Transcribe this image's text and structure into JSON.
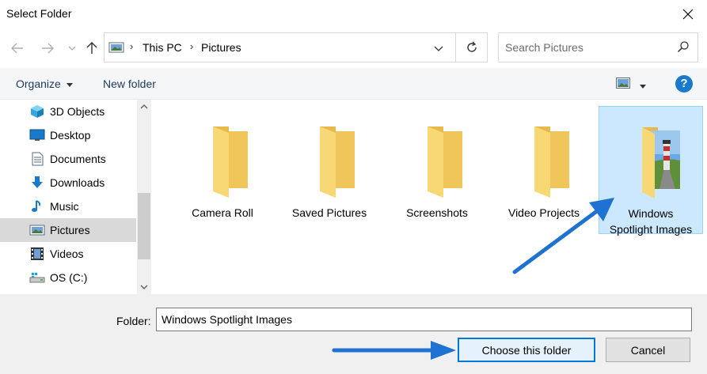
{
  "window": {
    "title": "Select Folder"
  },
  "nav": {
    "back_icon": "arrow-left-icon",
    "forward_icon": "arrow-right-icon",
    "recent_icon": "chevron-down-icon",
    "up_icon": "arrow-up-icon"
  },
  "address": {
    "segments": [
      "This PC",
      "Pictures"
    ]
  },
  "search": {
    "placeholder": "Search Pictures"
  },
  "toolbar": {
    "organize_label": "Organize",
    "new_folder_label": "New folder",
    "help_label": "?"
  },
  "sidebar": {
    "items": [
      {
        "label": "3D Objects",
        "icon": "cube-icon"
      },
      {
        "label": "Desktop",
        "icon": "desktop-icon"
      },
      {
        "label": "Documents",
        "icon": "document-icon"
      },
      {
        "label": "Downloads",
        "icon": "download-icon"
      },
      {
        "label": "Music",
        "icon": "music-icon"
      },
      {
        "label": "Pictures",
        "icon": "picture-icon",
        "selected": true
      },
      {
        "label": "Videos",
        "icon": "film-icon"
      },
      {
        "label": "OS (C:)",
        "icon": "drive-icon"
      }
    ]
  },
  "content": {
    "folders": [
      {
        "name": "Camera Roll"
      },
      {
        "name": "Saved Pictures"
      },
      {
        "name": "Screenshots"
      },
      {
        "name": "Video Projects"
      },
      {
        "name_line1": "Windows",
        "name_line2": "Spotlight Images",
        "selected": true
      }
    ]
  },
  "footer": {
    "folder_label": "Folder:",
    "folder_value": "Windows Spotlight Images",
    "choose_label": "Choose this folder",
    "cancel_label": "Cancel"
  },
  "colors": {
    "accent": "#0078d7",
    "arrow": "#1e73d2",
    "folder": "#f8d775",
    "selection": "#cce8ff"
  }
}
